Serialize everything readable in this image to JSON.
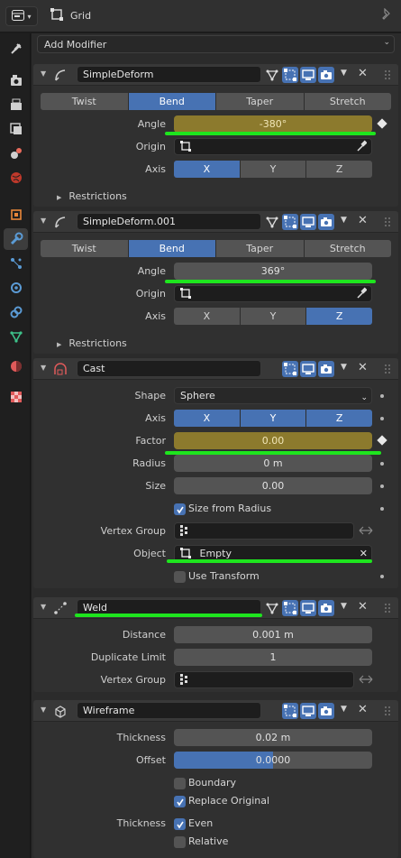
{
  "header": {
    "object_name": "Grid",
    "editor_icon": "properties-editor-icon",
    "pin_icon": "pin-icon"
  },
  "sidebar": {
    "tabs": [
      "tool-icon",
      "render-icon",
      "output-icon",
      "view-layer-icon",
      "scene-icon",
      "world-icon",
      "object-icon",
      "modifier-icon",
      "particles-icon",
      "physics-icon",
      "constraints-icon",
      "data-icon",
      "material-icon",
      "texture-icon"
    ],
    "active": "modifier-icon"
  },
  "add_modifier": "Add Modifier",
  "mod1": {
    "name": "SimpleDeform",
    "modes": [
      "Twist",
      "Bend",
      "Taper",
      "Stretch"
    ],
    "active_mode": "Bend",
    "angle_label": "Angle",
    "angle_value": "-380°",
    "origin_label": "Origin",
    "axis_label": "Axis",
    "axis": [
      "X",
      "Y",
      "Z"
    ],
    "active_axis": "X",
    "restrictions": "Restrictions"
  },
  "mod2": {
    "name": "SimpleDeform.001",
    "modes": [
      "Twist",
      "Bend",
      "Taper",
      "Stretch"
    ],
    "active_mode": "Bend",
    "angle_label": "Angle",
    "angle_value": "369°",
    "origin_label": "Origin",
    "axis_label": "Axis",
    "axis": [
      "X",
      "Y",
      "Z"
    ],
    "active_axis": "Z",
    "restrictions": "Restrictions"
  },
  "mod3": {
    "name": "Cast",
    "shape_label": "Shape",
    "shape_value": "Sphere",
    "axis_label": "Axis",
    "axis": [
      "X",
      "Y",
      "Z"
    ],
    "factor_label": "Factor",
    "factor_value": "0.00",
    "radius_label": "Radius",
    "radius_value": "0 m",
    "size_label": "Size",
    "size_value": "0.00",
    "size_from_radius": "Size from Radius",
    "vertex_group_label": "Vertex Group",
    "object_label": "Object",
    "object_value": "Empty",
    "use_transform": "Use Transform"
  },
  "mod4": {
    "name": "Weld",
    "distance_label": "Distance",
    "distance_value": "0.001 m",
    "dup_limit_label": "Duplicate Limit",
    "dup_limit_value": "1",
    "vertex_group_label": "Vertex Group"
  },
  "mod5": {
    "name": "Wireframe",
    "thickness_label": "Thickness",
    "thickness_value": "0.02 m",
    "offset_label": "Offset",
    "offset_value": "0.0000",
    "offset_fill": 0.5,
    "boundary": "Boundary",
    "replace_original": "Replace Original",
    "thickness2_label": "Thickness",
    "even": "Even",
    "relative": "Relative"
  },
  "colors": {
    "accent": "#4772b3",
    "animated": "#8c7a2d",
    "highlight": "#1ee51e"
  }
}
